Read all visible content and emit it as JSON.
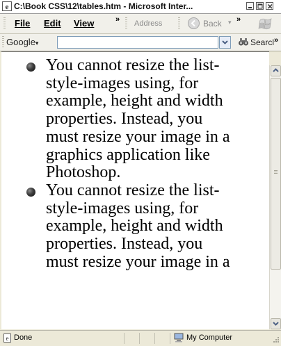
{
  "window": {
    "title": "C:\\Book CSS\\12\\tables.htm - Microsoft Inter..."
  },
  "menubar": {
    "file": "File",
    "edit": "Edit",
    "view": "View",
    "chevron": "»",
    "address_label": "Address",
    "back_label": "Back",
    "back_dropdown": "▾",
    "chevron2": "»"
  },
  "googlebar": {
    "label": "Google",
    "caret": "▾",
    "search_value": "",
    "search_button": "Searcl",
    "chevron": "»"
  },
  "content": {
    "items": [
      "You cannot resize the list-style-images using, for example, height and width properties. Instead, you must resize your image in a graphics application like Photoshop.",
      "You cannot resize the list-style-images using, for example, height and width properties. Instead, you must resize your image in a"
    ]
  },
  "statusbar": {
    "status": "Done",
    "zone": "My Computer"
  },
  "icons": {
    "title_icon": "ie-icon",
    "minimize": "minimize-icon",
    "maximize": "maximize-icon",
    "close": "close-icon",
    "back": "back-arrow-icon",
    "windows_logo": "windows-logo-icon",
    "search": "binoculars-icon",
    "combo": "chevron-down-icon",
    "scroll_up": "arrow-up-icon",
    "scroll_down": "arrow-down-icon",
    "page": "page-icon",
    "zone": "computer-icon"
  },
  "colors": {
    "xp_blue": "#2f6fd8",
    "xp_green": "#3f9b3a"
  }
}
